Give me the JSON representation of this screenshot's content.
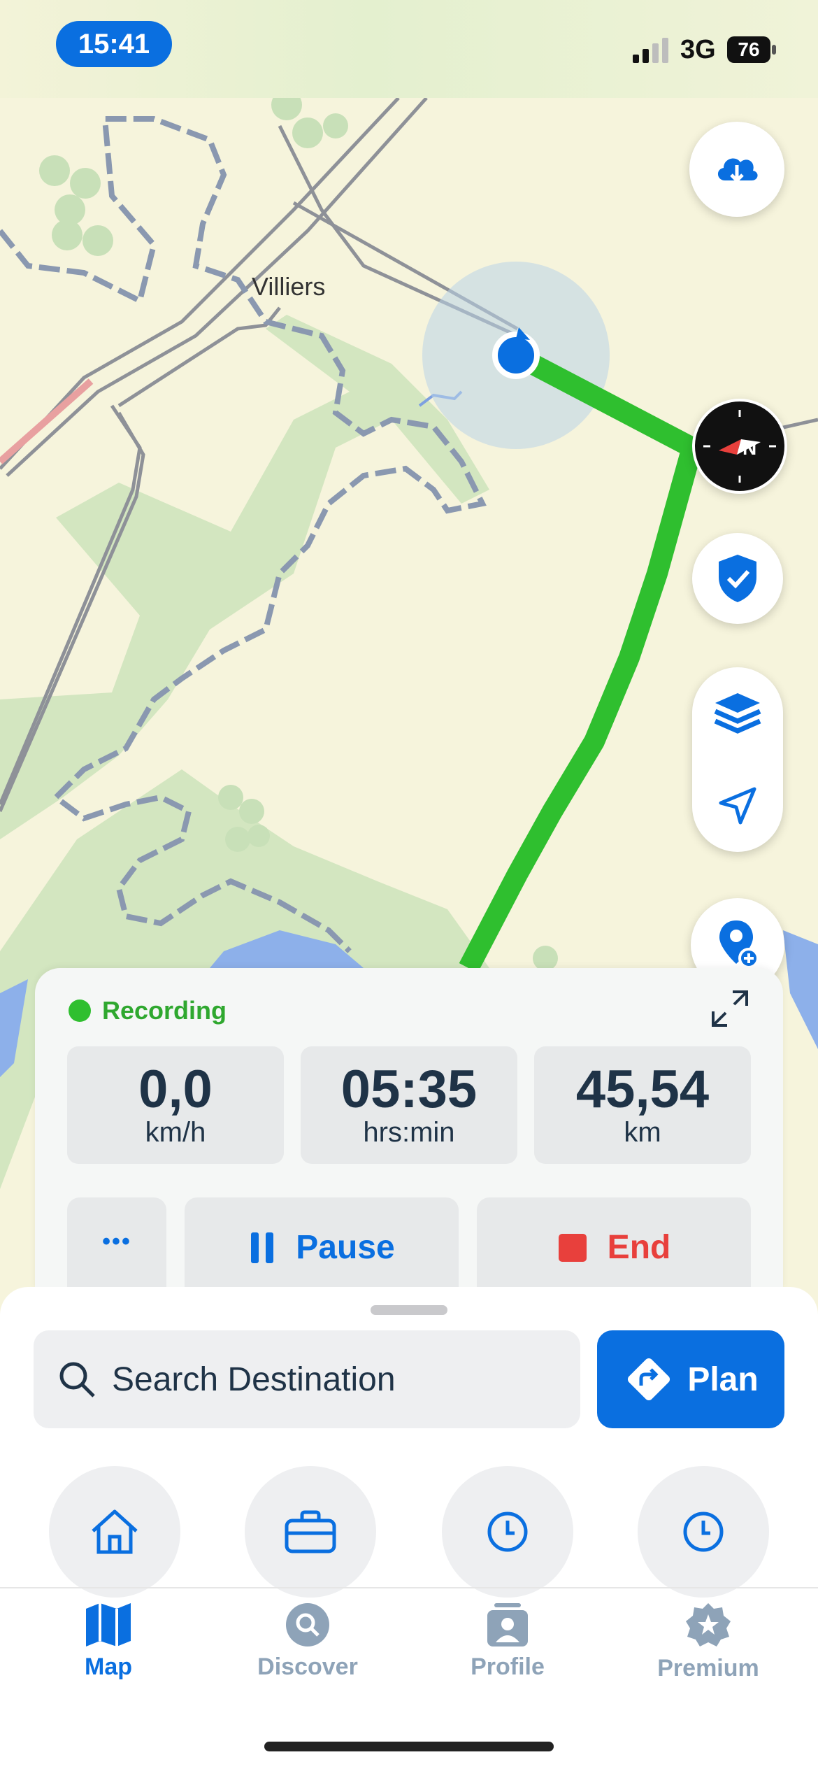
{
  "status_bar": {
    "time": "15:41",
    "network": "3G",
    "battery": "76"
  },
  "map": {
    "place_label": "Villiers",
    "compass_letter": "N"
  },
  "recording_panel": {
    "status": "Recording",
    "stats": [
      {
        "value": "0,0",
        "unit": "km/h"
      },
      {
        "value": "05:35",
        "unit": "hrs:min"
      },
      {
        "value": "45,54",
        "unit": "km"
      }
    ],
    "more_label": "•••",
    "pause_label": "Pause",
    "end_label": "End"
  },
  "search": {
    "placeholder": "Search Destination",
    "plan_label": "Plan"
  },
  "shortcuts": [
    "home-icon",
    "briefcase-icon",
    "clock-icon",
    "clock-icon"
  ],
  "tabs": [
    {
      "label": "Map",
      "active": true
    },
    {
      "label": "Discover",
      "active": false
    },
    {
      "label": "Profile",
      "active": false
    },
    {
      "label": "Premium",
      "active": false
    }
  ],
  "colors": {
    "accent": "#0a6fe0",
    "route": "#2fbf2f",
    "recording": "#2fa82f",
    "end": "#e8403c",
    "inactive_tab": "#8ea3b8"
  }
}
